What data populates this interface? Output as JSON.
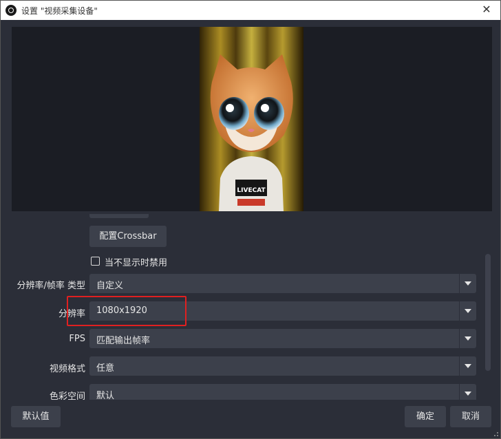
{
  "window": {
    "title": "设置 \"视频采集设备\"",
    "close_symbol": "✕"
  },
  "settings": {
    "crossbar_button": "配置Crossbar",
    "disable_when_hidden_label": "当不显示时禁用",
    "disable_when_hidden_checked": false,
    "rows": [
      {
        "label": "分辨率/帧率 类型",
        "value": "自定义"
      },
      {
        "label": "分辨率",
        "value": "1080x1920"
      },
      {
        "label": "FPS",
        "value": "匹配输出帧率"
      },
      {
        "label": "视频格式",
        "value": "任意"
      },
      {
        "label": "色彩空间",
        "value": "默认"
      }
    ],
    "highlight_color": "#e02020"
  },
  "footer": {
    "defaults_button": "默认值",
    "ok_button": "确定",
    "cancel_button": "取消"
  },
  "preview": {
    "badge_text": "LIVECAT"
  }
}
